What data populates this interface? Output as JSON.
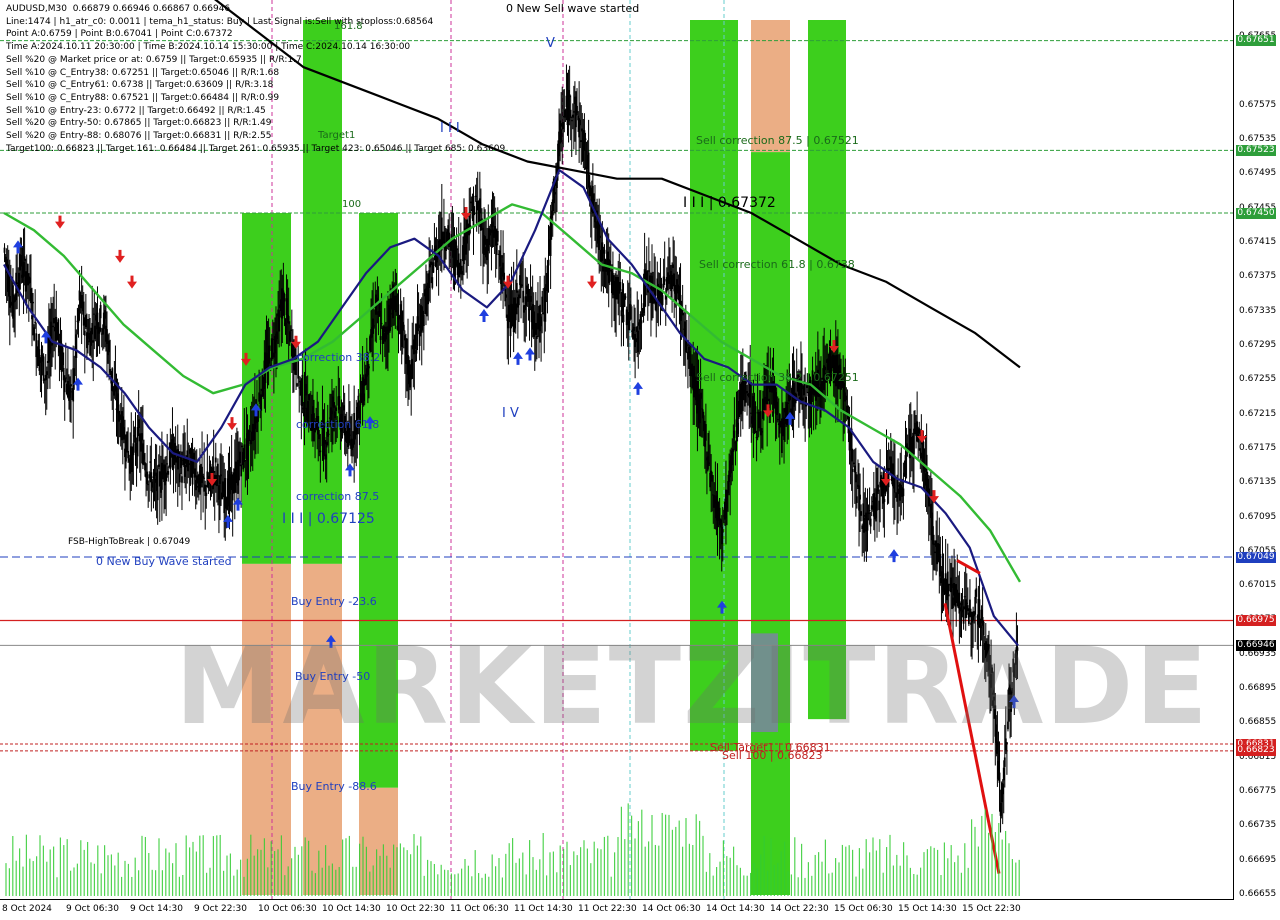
{
  "info_panel": [
    "AUDUSD,M30  0.66879 0.66946 0.66867 0.66946",
    "Line:1474 | h1_atr_c0: 0.0011 | tema_h1_status: Buy | Last Signal is:Sell with stoploss:0.68564",
    "Point A:0.6759 | Point B:0.67041 | Point C:0.67372",
    "Time A:2024.10.11 20:30:00 | Time B:2024.10.14 15:30:00 | Time C:2024.10.14 16:30:00",
    "Sell %20 @ Market price or at: 0.6759 || Target:0.65935 || R/R:1.7",
    "Sell %10 @ C_Entry38: 0.67251 || Target:0.65046 || R/R:1.68",
    "Sell %10 @ C_Entry61: 0.6738 || Target:0.63609 || R/R:3.18",
    "Sell %10 @ C_Entry88: 0.67521 || Target:0.66484 || R/R:0.99",
    "Sell %10 @ Entry-23: 0.6772 || Target:0.66492 || R/R:1.45",
    "Sell %20 @ Entry-50: 0.67865 || Target:0.66823 || R/R:1.49",
    "Sell %20 @ Entry-88: 0.68076 || Target:0.66831 || R/R:2.55",
    "Target100: 0.66823 || Target 161: 0.66484 || Target 261: 0.65935 || Target 423: 0.65046 || Target 685: 0.63609"
  ],
  "watermark": "MARKETZITRADE",
  "annotations": {
    "new_sell_wave": "0 New Sell wave started",
    "new_buy_wave": "0 New Buy Wave started",
    "wave_v": "V",
    "wave_iii": "I I I",
    "wave_iv": "I V",
    "point_c": "I I I | 0.67372",
    "point_b": "I I I | 0.67125",
    "fsb": "FSB-HighToBreak  |  0.67049",
    "sell_corr_875": "Sell correction 87.5 | 0.67521",
    "sell_corr_618": "Sell correction 61.8 | 0.6738",
    "sell_corr_382": "Sell correction 38.2 | 0.67251",
    "corr_382": "correction 38.2",
    "corr_618": "correction 61.8",
    "corr_875": "correction 87.5",
    "buy_entry_236": "Buy Entry -23.6",
    "buy_entry_50": "Buy Entry -50",
    "buy_entry_886": "Buy Entry -88.6",
    "sell_target1": "Sell Target1 | 0.66831",
    "sell_100": "Sell 100 | 0.66823",
    "target1": "Target1",
    "label_100": "100",
    "label_1618": "161.8"
  },
  "price_tags": [
    {
      "value": "0.67651",
      "color": "#2e9e3a"
    },
    {
      "value": "0.67523",
      "color": "#2e9e3a"
    },
    {
      "value": "0.67450",
      "color": "#2e9e3a"
    },
    {
      "value": "0.67049",
      "color": "#1f3fbf"
    },
    {
      "value": "0.66975",
      "color": "#d42020"
    },
    {
      "value": "0.66946",
      "color": "#000000"
    },
    {
      "value": "0.66831",
      "color": "#d42020"
    },
    {
      "value": "0.66823",
      "color": "#d42020"
    }
  ],
  "colors": {
    "green_zone": "#33cc11",
    "orange_zone": "#e8a070",
    "candle": "#000000",
    "ma_fast": "#1a1a80",
    "ma_mid": "#33bb33",
    "ma_slow": "#000000",
    "buy_arrow": "#1f3fdf",
    "sell_arrow": "#e02020",
    "dashed_level": "#1f3fbf",
    "target_level": "#c02020"
  },
  "chart_data": {
    "type": "candlestick",
    "symbol": "AUDUSD",
    "timeframe": "M30",
    "ylim": [
      0.66655,
      0.67675
    ],
    "y_ticks": [
      "0.67655",
      "0.67575",
      "0.67535",
      "0.67495",
      "0.67455",
      "0.67415",
      "0.67375",
      "0.67335",
      "0.67295",
      "0.67255",
      "0.67215",
      "0.67175",
      "0.67135",
      "0.67095",
      "0.67055",
      "0.67015",
      "0.66975",
      "0.66935",
      "0.66895",
      "0.66855",
      "0.66815",
      "0.66775",
      "0.66735",
      "0.66695",
      "0.66655"
    ],
    "x_ticks": [
      "8 Oct 2024",
      "9 Oct 06:30",
      "9 Oct 14:30",
      "9 Oct 22:30",
      "10 Oct 06:30",
      "10 Oct 14:30",
      "10 Oct 22:30",
      "11 Oct 06:30",
      "11 Oct 14:30",
      "11 Oct 22:30",
      "14 Oct 06:30",
      "14 Oct 14:30",
      "14 Oct 22:30",
      "15 Oct 06:30",
      "15 Oct 14:30",
      "15 Oct 22:30"
    ],
    "levels": {
      "fsb_high_to_break": 0.67049,
      "point_a": 0.6759,
      "point_b": 0.67041,
      "point_c": 0.67372,
      "target_100": 0.66823,
      "sell_target1": 0.66831,
      "current_price": 0.66946,
      "resistance_red": 0.66975,
      "sell_correction_875": 0.67521,
      "sell_correction_618": 0.6738,
      "sell_correction_382": 0.67251
    },
    "price_path": [
      0.6741,
      0.6734,
      0.6739,
      0.6737,
      0.6729,
      0.6726,
      0.6733,
      0.6727,
      0.6723,
      0.6735,
      0.673,
      0.6733,
      0.6732,
      0.6724,
      0.672,
      0.6716,
      0.6719,
      0.6715,
      0.6713,
      0.6715,
      0.6717,
      0.6715,
      0.6716,
      0.6714,
      0.6713,
      0.6715,
      0.6712,
      0.6713,
      0.6716,
      0.6718,
      0.6722,
      0.6727,
      0.673,
      0.6735,
      0.673,
      0.6725,
      0.6722,
      0.672,
      0.6718,
      0.6723,
      0.6721,
      0.6718,
      0.6722,
      0.6727,
      0.6734,
      0.673,
      0.6735,
      0.6732,
      0.6726,
      0.6731,
      0.6735,
      0.674,
      0.6743,
      0.6741,
      0.6739,
      0.6744,
      0.6746,
      0.6741,
      0.6743,
      0.6738,
      0.6732,
      0.6736,
      0.6735,
      0.6731,
      0.6734,
      0.6746,
      0.6755,
      0.6758,
      0.6756,
      0.6751,
      0.6744,
      0.674,
      0.6737,
      0.6735,
      0.6733,
      0.673,
      0.6738,
      0.6735,
      0.6736,
      0.6738,
      0.6735,
      0.6728,
      0.6724,
      0.6719,
      0.6712,
      0.6708,
      0.6715,
      0.6723,
      0.6725,
      0.672,
      0.6722,
      0.6725,
      0.6719,
      0.6723,
      0.6725,
      0.6724,
      0.6725,
      0.6726,
      0.6727,
      0.6726,
      0.672,
      0.6712,
      0.6709,
      0.6711,
      0.6713,
      0.6715,
      0.6711,
      0.6718,
      0.6719,
      0.6716,
      0.6707,
      0.6703,
      0.6701,
      0.67,
      0.6698,
      0.67,
      0.6696,
      0.669,
      0.6676,
      0.6688,
      0.66946
    ],
    "ma_fast": [
      0.6739,
      0.6734,
      0.673,
      0.6729,
      0.6727,
      0.6724,
      0.672,
      0.6717,
      0.6716,
      0.672,
      0.6725,
      0.6727,
      0.6728,
      0.673,
      0.6734,
      0.6738,
      0.6741,
      0.6742,
      0.674,
      0.6736,
      0.6734,
      0.6737,
      0.6743,
      0.675,
      0.6748,
      0.6742,
      0.6739,
      0.6735,
      0.6731,
      0.6728,
      0.6727,
      0.6725,
      0.6725,
      0.6723,
      0.6722,
      0.672,
      0.6716,
      0.6714,
      0.6713,
      0.671,
      0.6706,
      0.6698,
      0.66946
    ],
    "ma_mid": [
      0.6745,
      0.6743,
      0.674,
      0.6736,
      0.6732,
      0.6729,
      0.6726,
      0.6724,
      0.6725,
      0.6727,
      0.6728,
      0.673,
      0.6733,
      0.6736,
      0.6739,
      0.6742,
      0.6744,
      0.6746,
      0.6745,
      0.6742,
      0.6739,
      0.6738,
      0.6736,
      0.6733,
      0.673,
      0.6728,
      0.6726,
      0.6725,
      0.6722,
      0.672,
      0.6718,
      0.6715,
      0.6712,
      0.6708,
      0.6702
    ],
    "ma_slow": [
      0.677,
      0.6766,
      0.6762,
      0.676,
      0.6758,
      0.6756,
      0.6753,
      0.6751,
      0.675,
      0.6749,
      0.6749,
      0.6747,
      0.6745,
      0.6742,
      0.6739,
      0.6737,
      0.6734,
      0.6731,
      0.6727
    ],
    "zones": [
      {
        "kind": "green",
        "from_bar": 242,
        "to_bar": 291,
        "top": 0.6745,
        "bottom": 0.67041
      },
      {
        "kind": "green",
        "from_bar": 303,
        "to_bar": 342,
        "top": 0.67675,
        "bottom": 0.67041
      },
      {
        "kind": "green",
        "from_bar": 359,
        "to_bar": 398,
        "top": 0.6745,
        "bottom": 0.6678
      },
      {
        "kind": "orange",
        "from_bar": 242,
        "to_bar": 291,
        "top": 0.67041,
        "bottom": 0.66655
      },
      {
        "kind": "orange",
        "from_bar": 303,
        "to_bar": 342,
        "top": 0.67041,
        "bottom": 0.66655
      },
      {
        "kind": "orange",
        "from_bar": 359,
        "to_bar": 398,
        "top": 0.6678,
        "bottom": 0.66655
      },
      {
        "kind": "green",
        "from_bar": 690,
        "to_bar": 738,
        "top": 0.67675,
        "bottom": 0.66823
      },
      {
        "kind": "orange",
        "from_bar": 751,
        "to_bar": 790,
        "top": 0.67675,
        "bottom": 0.67521
      },
      {
        "kind": "green",
        "from_bar": 751,
        "to_bar": 790,
        "top": 0.67521,
        "bottom": 0.66655
      },
      {
        "kind": "green",
        "from_bar": 808,
        "to_bar": 846,
        "top": 0.67675,
        "bottom": 0.6686
      }
    ]
  }
}
